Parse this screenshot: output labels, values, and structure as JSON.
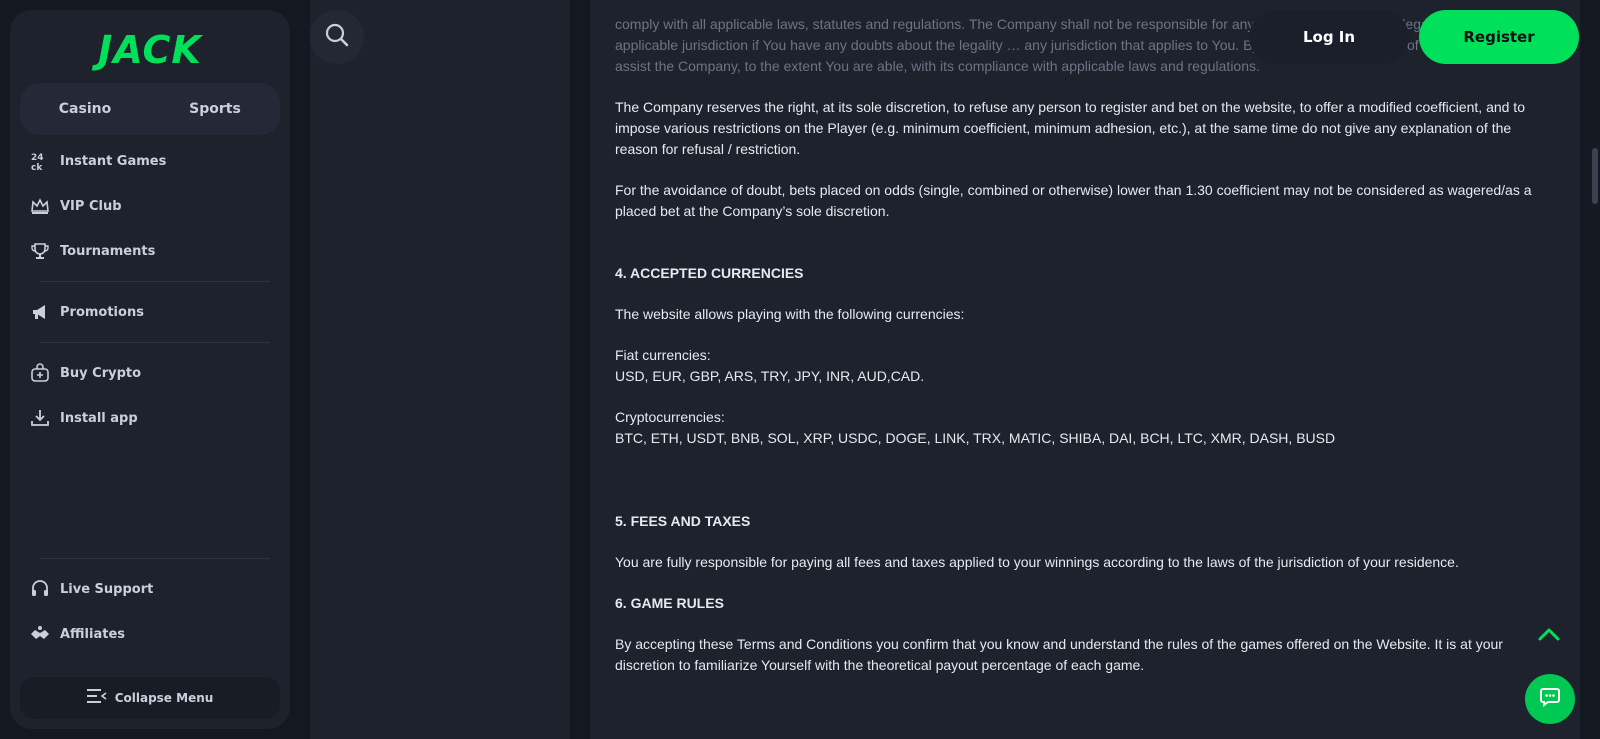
{
  "brand": {
    "logo_text": "JACK",
    "accent": "#00e05a"
  },
  "sidebar": {
    "tabs": [
      {
        "label": "Casino"
      },
      {
        "label": "Sports"
      }
    ],
    "items": [
      {
        "label": "Instant Games",
        "icon": "instant-games-icon"
      },
      {
        "label": "VIP Club",
        "icon": "crown-icon"
      },
      {
        "label": "Tournaments",
        "icon": "trophy-icon"
      },
      {
        "label": "Promotions",
        "icon": "megaphone-icon"
      },
      {
        "label": "Buy Crypto",
        "icon": "buy-crypto-icon"
      },
      {
        "label": "Install app",
        "icon": "download-icon"
      },
      {
        "label": "Live Support",
        "icon": "headset-icon"
      },
      {
        "label": "Affiliates",
        "icon": "handshake-icon"
      }
    ],
    "collapse_label": "Collapse Menu"
  },
  "header": {
    "login_label": "Log In",
    "register_label": "Register"
  },
  "content": {
    "p_top": "comply with all applicable laws, statutes and regulations. The Company shall not be responsible for any … You. Please consult legal counsel in the applicable jurisdiction if You have any doubts about the legality … any jurisdiction that applies to You. By accepting these Terms of Use, You agree to assist the Company, to the extent You are able, with its compliance with applicable laws and regulations.",
    "p_refuse": "The Company reserves the right, at its sole discretion, to refuse any person to register and bet on the website, to offer a modified coefficient, and to impose various restrictions on the Player (e.g. minimum coefficient, minimum adhesion, etc.), at the same time do not give any explanation of the reason for refusal / restriction.",
    "p_odds": "For the avoidance of doubt, bets placed on odds (single, combined or otherwise) lower than 1.30 coefficient may not be considered as wagered/as a placed bet at the Company’s sole discretion.",
    "h4": "4. ACCEPTED CURRENCIES",
    "p_allows": "The website allows playing with the following currencies:",
    "fiat_label": "Fiat currencies:",
    "fiat_list": "USD, EUR, GBP, ARS, TRY, JPY, INR, AUD,CAD.",
    "crypto_label": "Cryptocurrencies:",
    "crypto_list": "BTC, ETH, USDT, BNB, SOL, XRP, USDC, DOGE, LINK, TRX, MATIC, SHIBA, DAI, BCH, LTC, XMR, DASH, BUSD",
    "h5": "5.  FEES AND TAXES",
    "p_fees": "You are fully responsible for paying all fees and taxes applied to your winnings according to the laws of the jurisdiction of your residence.",
    "h6": "6. GAME RULES",
    "p_rules": "By accepting these Terms and Conditions you confirm that you know and understand the rules of the games offered on the Website. It is at your discretion to familiarize Yourself with the theoretical payout percentage of each game."
  }
}
